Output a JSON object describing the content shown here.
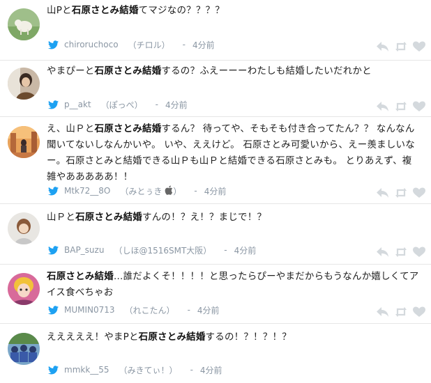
{
  "tweets": [
    {
      "text_parts": [
        {
          "t": "山Pと",
          "b": false
        },
        {
          "t": "石原さとみ結婚",
          "b": true
        },
        {
          "t": "てマジなの？？？？",
          "b": false
        }
      ],
      "handle": "chiroruchoco",
      "display_name": "（チロル）",
      "separator": "-",
      "time": "4分前"
    },
    {
      "text_parts": [
        {
          "t": "やまぴーと",
          "b": false
        },
        {
          "t": "石原さとみ結婚",
          "b": true
        },
        {
          "t": "するの？ふえーーーわたしも結婚したいだれかと",
          "b": false
        }
      ],
      "handle": "p__akt",
      "display_name": "（ぽっぺ）",
      "separator": "-",
      "time": "4分前"
    },
    {
      "text_parts": [
        {
          "t": "え、山Ｐと",
          "b": false
        },
        {
          "t": "石原さとみ結婚",
          "b": true
        },
        {
          "t": "するん？ 待ってや、そもそも付き合ってたん？？ なんなん聞いてないしなんかいや。 いや、ええけど。 石原さとみ可愛いから、えー羨ましいなー。石原さとみと結婚できる山Ｐも山Ｐと結婚できる石原さとみも。 とりあえず、複雑やあああああ！！",
          "b": false
        }
      ],
      "handle": "Mtk72__8O",
      "display_name": "（みとぅき",
      "display_name_end": "）",
      "separator": "-",
      "time": "4分前"
    },
    {
      "text_parts": [
        {
          "t": "山Ｐと",
          "b": false
        },
        {
          "t": "石原さとみ結婚",
          "b": true
        },
        {
          "t": "すんの！？え！？まじで！？",
          "b": false
        }
      ],
      "handle": "BAP_suzu",
      "display_name": "（しほ@1516SMT大阪）",
      "separator": "-",
      "time": "4分前"
    },
    {
      "text_parts": [
        {
          "t": "石原さとみ結婚",
          "b": true
        },
        {
          "t": "…誰だよくそ！！！！と思ったらぴーやまだからもうなんか嬉しくてアイス食べちゃお",
          "b": false
        }
      ],
      "handle": "MUMIN0713",
      "display_name": "（れこたん）",
      "separator": "-",
      "time": "4分前"
    },
    {
      "text_parts": [
        {
          "t": "えええええ！やまPと",
          "b": false
        },
        {
          "t": "石原さとみ結婚",
          "b": true
        },
        {
          "t": "するの！？！？！？",
          "b": false
        }
      ],
      "handle": "mmkk__55",
      "display_name": "（みきてぃ！）",
      "separator": "-",
      "time": "4分前"
    }
  ],
  "icons": {
    "bird": "twitter-bird-icon",
    "reply": "reply-icon",
    "retweet": "retweet-icon",
    "favorite": "heart-icon",
    "apple": "apple-icon"
  },
  "colors": {
    "brand_blue": "#1da1f2",
    "meta_gray": "#8a96a3",
    "action_gray": "#d4d9dd",
    "divider": "#e6e6e6"
  }
}
